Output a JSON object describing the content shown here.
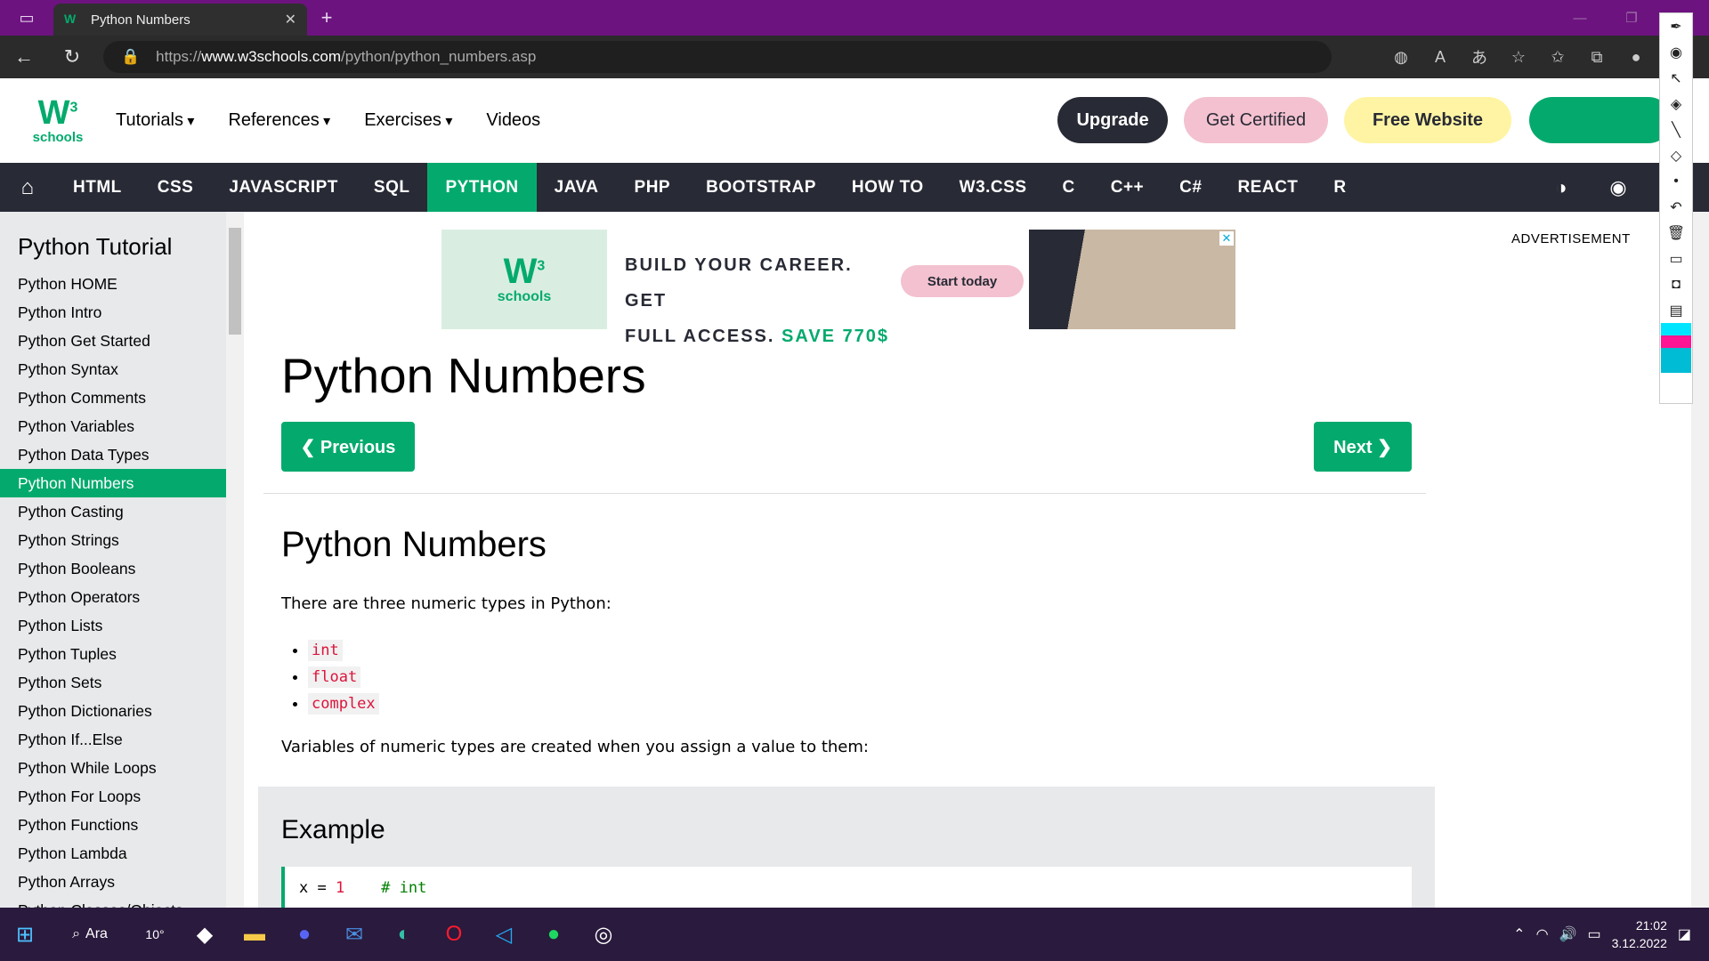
{
  "browser": {
    "tab_title": "Python Numbers",
    "url_prefix": "https://",
    "url_host": "www.w3schools.com",
    "url_path": "/python/python_numbers.asp"
  },
  "topnav": {
    "logo_w": "W",
    "logo_sup": "3",
    "logo_text": "schools",
    "menu": [
      "Tutorials",
      "References",
      "Exercises",
      "Videos"
    ],
    "upgrade": "Upgrade",
    "get_certified": "Get Certified",
    "free_website": "Free Website"
  },
  "subjects": [
    "HTML",
    "CSS",
    "JAVASCRIPT",
    "SQL",
    "PYTHON",
    "JAVA",
    "PHP",
    "BOOTSTRAP",
    "HOW TO",
    "W3.CSS",
    "C",
    "C++",
    "C#",
    "REACT",
    "R"
  ],
  "active_subject": "PYTHON",
  "sidebar": {
    "heading": "Python Tutorial",
    "items": [
      "Python HOME",
      "Python Intro",
      "Python Get Started",
      "Python Syntax",
      "Python Comments",
      "Python Variables",
      "Python Data Types",
      "Python Numbers",
      "Python Casting",
      "Python Strings",
      "Python Booleans",
      "Python Operators",
      "Python Lists",
      "Python Tuples",
      "Python Sets",
      "Python Dictionaries",
      "Python If...Else",
      "Python While Loops",
      "Python For Loops",
      "Python Functions",
      "Python Lambda",
      "Python Arrays",
      "Python Classes/Objects"
    ],
    "active": "Python Numbers"
  },
  "ad": {
    "line1": "BUILD YOUR CAREER. GET",
    "line2": "FULL ACCESS.",
    "save": "SAVE 770$",
    "cta": "Start today",
    "label": "ADVERTISEMENT"
  },
  "content": {
    "title": "Python Numbers",
    "previous": "❮ Previous",
    "next": "Next ❯",
    "subtitle": "Python Numbers",
    "intro": "There are three numeric types in Python:",
    "types": [
      "int",
      "float",
      "complex"
    ],
    "desc": "Variables of numeric types are created when you assign a value to them:",
    "example_heading": "Example",
    "code_var": "x = ",
    "code_num": "1",
    "code_comment": "# int"
  },
  "taskbar": {
    "search": "Ara",
    "weather": "10°",
    "time": "21:02",
    "date": "3.12.2022"
  }
}
